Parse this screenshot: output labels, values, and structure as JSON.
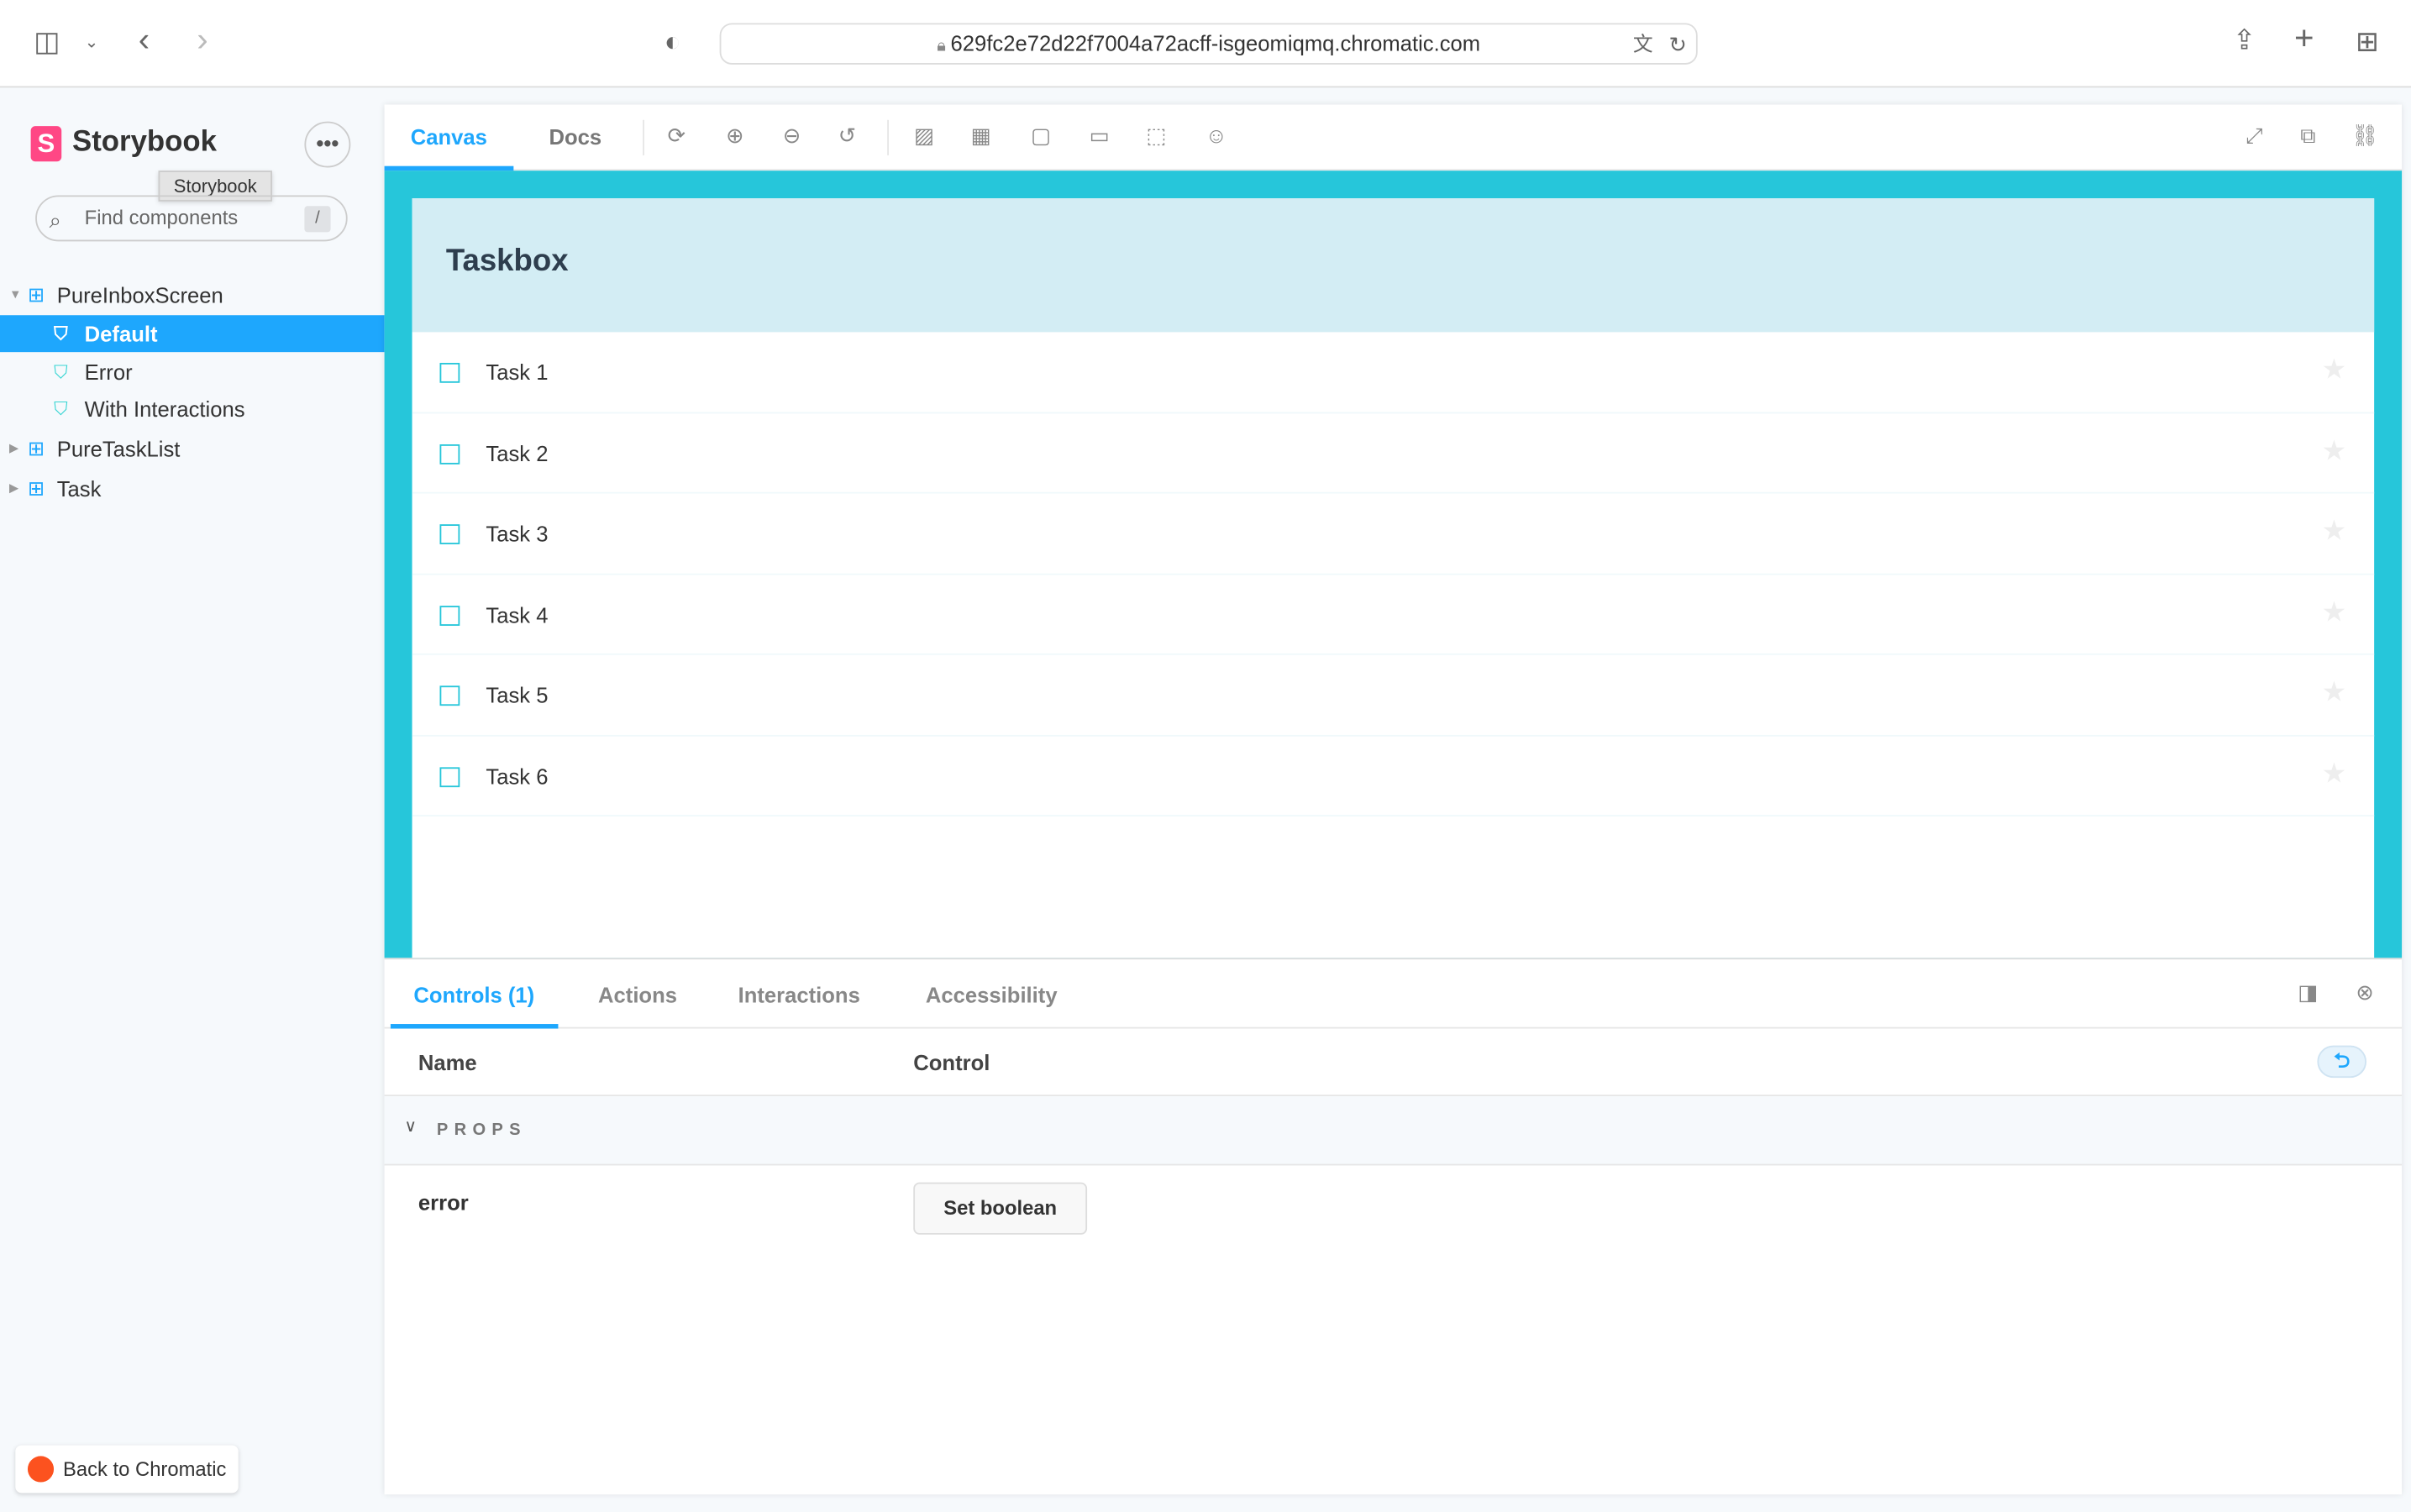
{
  "browser": {
    "url": "629fc2e72d22f7004a72acff-isgeomiqmq.chromatic.com"
  },
  "sidebar": {
    "brand": "Storybook",
    "tooltip": "Storybook",
    "search_placeholder": "Find components",
    "search_shortcut": "/",
    "items": [
      {
        "label": "PureInboxScreen",
        "type": "component",
        "expanded": true
      },
      {
        "label": "Default",
        "type": "story",
        "selected": true
      },
      {
        "label": "Error",
        "type": "story"
      },
      {
        "label": "With Interactions",
        "type": "story"
      },
      {
        "label": "PureTaskList",
        "type": "component"
      },
      {
        "label": "Task",
        "type": "component"
      }
    ],
    "back_button": "Back to Chromatic"
  },
  "toolbar": {
    "tabs": [
      "Canvas",
      "Docs"
    ],
    "active_tab": "Canvas"
  },
  "preview": {
    "title": "Taskbox",
    "tasks": [
      "Task 1",
      "Task 2",
      "Task 3",
      "Task 4",
      "Task 5",
      "Task 6"
    ],
    "accent": "#26c6da"
  },
  "addons": {
    "tabs": [
      "Controls (1)",
      "Actions",
      "Interactions",
      "Accessibility"
    ],
    "active": "Controls (1)",
    "headers": {
      "name": "Name",
      "control": "Control"
    },
    "section": "PROPS",
    "rows": [
      {
        "name": "error",
        "control": "Set boolean"
      }
    ]
  },
  "colors": {
    "primary": "#1ea7fd",
    "storybook": "#ff4785",
    "chromatic": "#fc521f"
  }
}
